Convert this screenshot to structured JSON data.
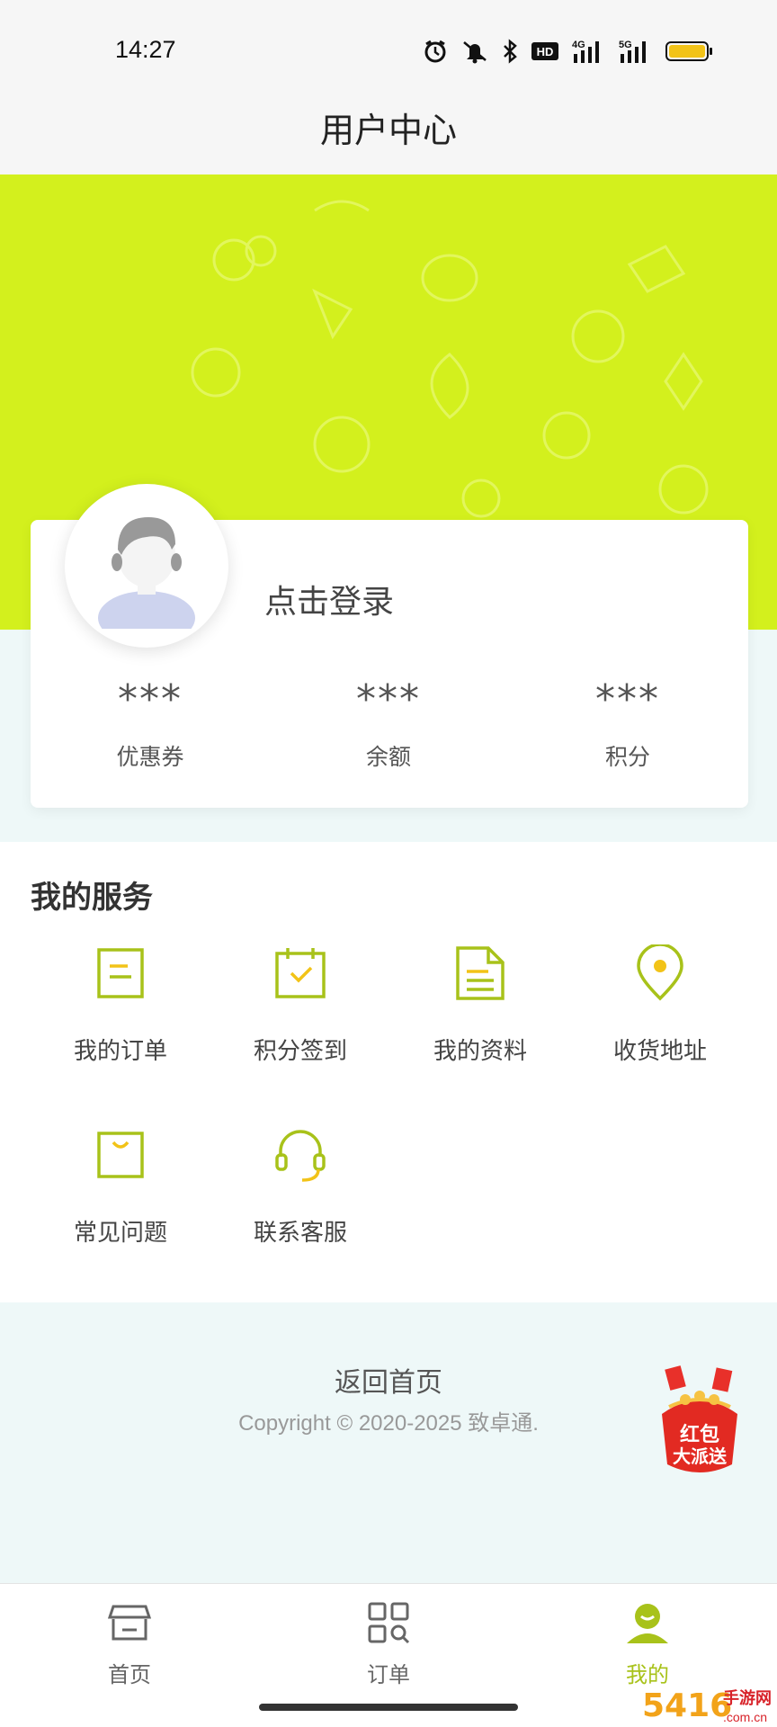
{
  "status_bar": {
    "time": "14:27",
    "icons": [
      "alarm-icon",
      "mute-icon",
      "bluetooth-icon",
      "hd-icon",
      "signal-4g-icon",
      "signal-5g-icon",
      "battery-icon"
    ],
    "net1": "4G",
    "net2": "5G",
    "hd": "HD"
  },
  "header": {
    "title": "用户中心"
  },
  "profile": {
    "login_text": "点击登录",
    "stats": [
      {
        "value": "***",
        "label": "优惠券"
      },
      {
        "value": "***",
        "label": "余额"
      },
      {
        "value": "***",
        "label": "积分"
      }
    ]
  },
  "services": {
    "title": "我的服务",
    "items": [
      {
        "label": "我的订单",
        "icon": "order-icon"
      },
      {
        "label": "积分签到",
        "icon": "calendar-check-icon"
      },
      {
        "label": "我的资料",
        "icon": "document-icon"
      },
      {
        "label": "收货地址",
        "icon": "location-pin-icon"
      },
      {
        "label": "常见问题",
        "icon": "bag-icon"
      },
      {
        "label": "联系客服",
        "icon": "headset-icon"
      }
    ]
  },
  "footer": {
    "back_home": "返回首页",
    "copyright": "Copyright © 2020-2025 致卓通."
  },
  "promo": {
    "line1": "红包",
    "line2": "大派送"
  },
  "tabbar": {
    "items": [
      {
        "label": "首页",
        "icon": "store-icon",
        "active": false
      },
      {
        "label": "订单",
        "icon": "grid-search-icon",
        "active": false
      },
      {
        "label": "我的",
        "icon": "user-icon",
        "active": true
      }
    ]
  },
  "watermark": {
    "brand": "5416",
    "text": "手游网",
    "domain": ".com.cn"
  },
  "colors": {
    "accent": "#d3f01d",
    "icon_green": "#a8c21a",
    "icon_yellow": "#f2c318",
    "background": "#eef8f8"
  }
}
